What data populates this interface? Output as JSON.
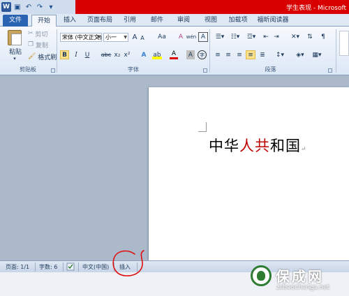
{
  "window": {
    "title": "学生表现 - Microsoft"
  },
  "qat": {
    "app_icon": "W",
    "save_icon": "save-icon",
    "undo_icon": "undo-icon",
    "redo_icon": "redo-icon"
  },
  "tabs": [
    {
      "label": "文件"
    },
    {
      "label": "开始"
    },
    {
      "label": "插入"
    },
    {
      "label": "页面布局"
    },
    {
      "label": "引用"
    },
    {
      "label": "邮件"
    },
    {
      "label": "审阅"
    },
    {
      "label": "视图"
    },
    {
      "label": "加载项"
    },
    {
      "label": "福昕阅读器"
    }
  ],
  "clipboard": {
    "paste": "粘贴",
    "cut": "剪切",
    "copy": "复制",
    "format_painter": "格式刷",
    "group_label": "剪贴板"
  },
  "font": {
    "name": "宋体 (中文正文)",
    "size": "小一",
    "grow": "A",
    "shrink": "A",
    "case": "Aa",
    "clear": "A",
    "phonetic": "wén",
    "char_border": "A",
    "bold": "B",
    "italic": "I",
    "underline": "U",
    "strike": "abc",
    "subscript": "x₂",
    "superscript": "x²",
    "text_effects": "A",
    "highlight": "ab",
    "font_color": "A",
    "char_shading": "A",
    "enclosed": "字",
    "group_label": "字体"
  },
  "paragraph": {
    "group_label": "段落"
  },
  "document": {
    "text_before": "中华",
    "text_red": "人共",
    "text_after": "和国",
    "paragraph_mark": "↵"
  },
  "status": {
    "page": "页面: 1/1",
    "words": "字数: 6",
    "language": "中文(中国)",
    "mode": "插入"
  },
  "watermark": {
    "name": "保成网",
    "url": "zsbaochengs.net"
  },
  "colors": {
    "accent_red": "#c00000",
    "title_red": "#d80000",
    "file_tab": "#2a63b1"
  }
}
